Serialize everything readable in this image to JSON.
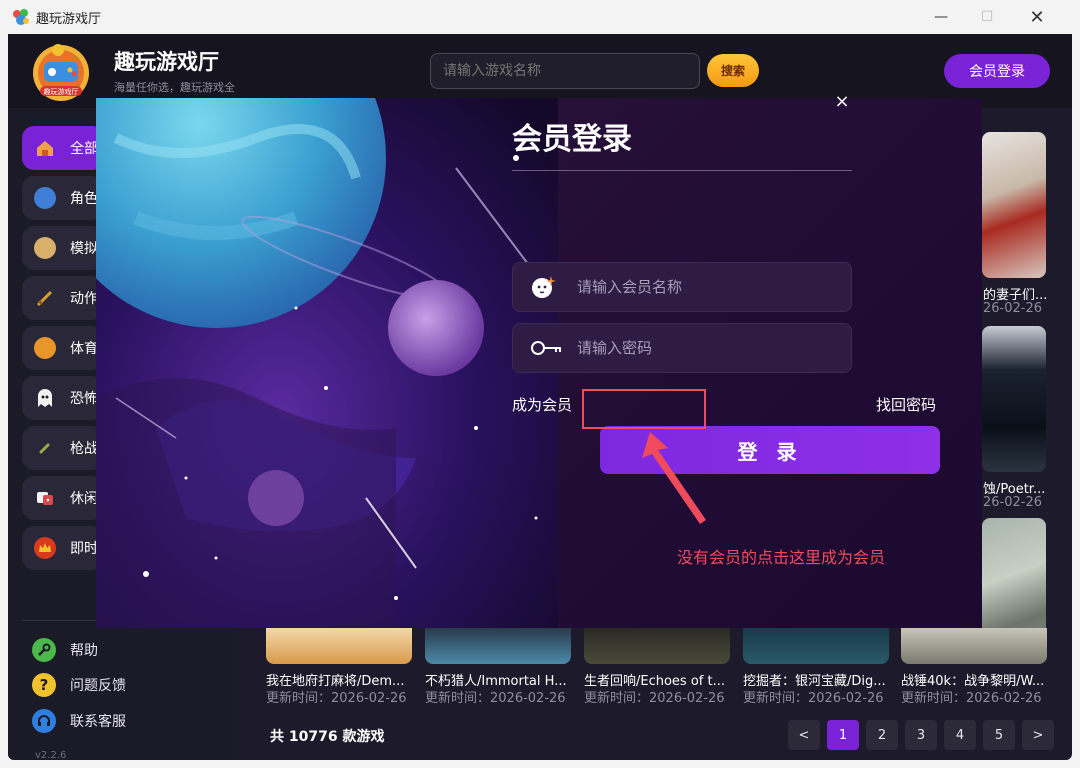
{
  "window": {
    "title": "趣玩游戏厅",
    "controls": [
      "minimize",
      "maximize",
      "close"
    ]
  },
  "header": {
    "brand": "趣玩游戏厅",
    "slogan": "海量任你选，趣玩游戏全",
    "logo_text": "趣玩游戏厅",
    "search_placeholder": "请输入游戏名称",
    "search_button": "搜索",
    "member_login_button": "会员登录"
  },
  "sidebar": {
    "items": [
      {
        "label": "全部",
        "icon": "home-icon",
        "color": "#e8a34a"
      },
      {
        "label": "角色",
        "icon": "character-icon",
        "color": "#3f7fd8"
      },
      {
        "label": "模拟",
        "icon": "simulation-icon",
        "color": "#d8b06a"
      },
      {
        "label": "动作",
        "icon": "sword-icon",
        "color": "#d6a12b"
      },
      {
        "label": "体育",
        "icon": "ball-icon",
        "color": "#e8952a"
      },
      {
        "label": "恐怖",
        "icon": "ghost-icon",
        "color": "#f2f2f2"
      },
      {
        "label": "枪战",
        "icon": "bullet-icon",
        "color": "#9fa64a"
      },
      {
        "label": "休闲",
        "icon": "dice-icon",
        "color": "#d84a4a"
      },
      {
        "label": "即时",
        "icon": "crown-icon",
        "color": "#d83a1e"
      }
    ],
    "help": [
      {
        "label": "帮助",
        "icon": "wrench-icon",
        "color": "#4ab84a"
      },
      {
        "label": "问题反馈",
        "icon": "question-icon",
        "color": "#f2c12e"
      },
      {
        "label": "联系客服",
        "icon": "headset-icon",
        "color": "#2f7fe0"
      }
    ],
    "version": "v2.2.6"
  },
  "right_cards": [
    {
      "title": "的妻子们...",
      "date": "26-02-26"
    },
    {
      "title": "蚀/Poetr...",
      "date": "26-02-26"
    }
  ],
  "bottom_cards": [
    {
      "title": "我在地府打麻将/Dem...",
      "date": "更新时间：2026-02-26"
    },
    {
      "title": "不朽猎人/Immortal H...",
      "date": "更新时间：2026-02-26"
    },
    {
      "title": "生者回响/Echoes of t...",
      "date": "更新时间：2026-02-26"
    },
    {
      "title": "挖掘者：银河宝藏/Dig...",
      "date": "更新时间：2026-02-26"
    },
    {
      "title": "战锤40k：战争黎明/W...",
      "date": "更新时间：2026-02-26"
    }
  ],
  "footer": {
    "total": "共 10776 款游戏",
    "pagination": [
      "<",
      "1",
      "2",
      "3",
      "4",
      "5",
      ">"
    ],
    "current_page": "1"
  },
  "login_modal": {
    "title": "会员登录",
    "close": "×",
    "username_placeholder": "请输入会员名称",
    "password_placeholder": "请输入密码",
    "become_member": "成为会员",
    "forgot_password": "找回密码",
    "login_button": "登 录"
  },
  "annotation": {
    "text": "没有会员的点击这里成为会员",
    "color": "#f04b5d"
  },
  "colors": {
    "accent": "#7a22d6",
    "search_button": "#f5a623",
    "app_background": "#1d1b2b"
  }
}
